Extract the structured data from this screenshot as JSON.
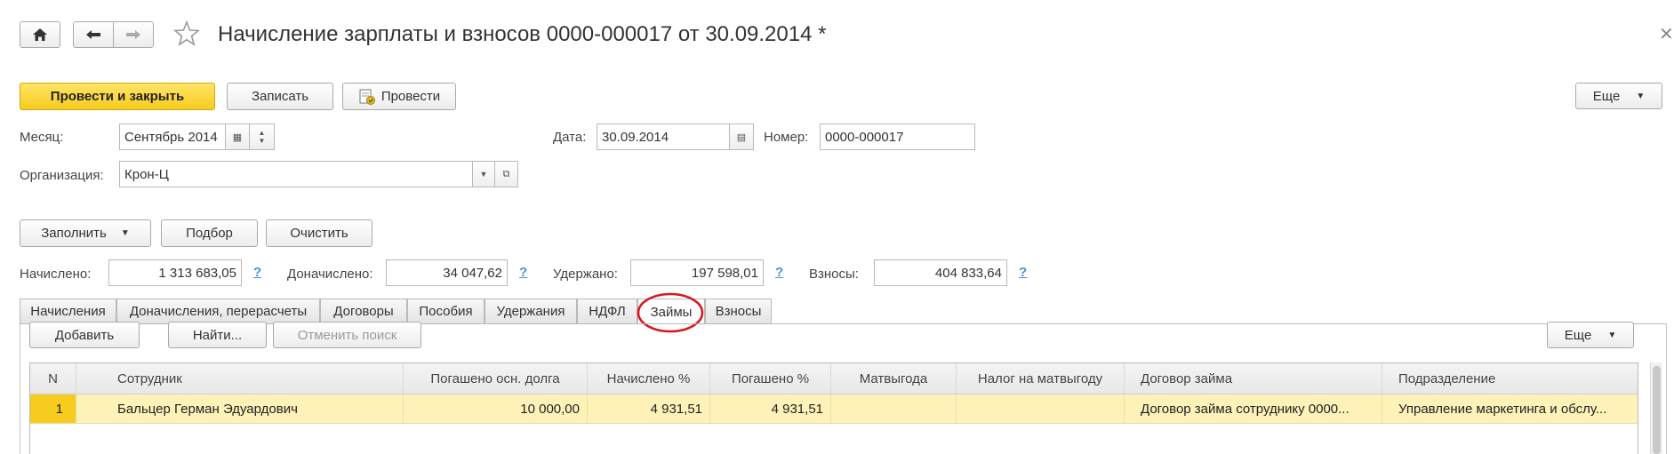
{
  "window": {
    "title": "Начисление зарплаты и взносов 0000-000017 от 30.09.2014 *"
  },
  "toolbar": {
    "post_close": "Провести и закрыть",
    "save": "Записать",
    "post": "Провести",
    "more": "Еще"
  },
  "header": {
    "month_label": "Месяц:",
    "month_value": "Сентябрь 2014",
    "date_label": "Дата:",
    "date_value": "30.09.2014",
    "number_label": "Номер:",
    "number_value": "0000-000017",
    "org_label": "Организация:",
    "org_value": "Крон-Ц"
  },
  "actions": {
    "fill": "Заполнить",
    "select": "Подбор",
    "clear": "Очистить"
  },
  "totals": {
    "accrued_label": "Начислено:",
    "accrued_value": "1 313 683,05",
    "additional_label": "Доначислено:",
    "additional_value": "34 047,62",
    "withheld_label": "Удержано:",
    "withheld_value": "197 598,01",
    "contrib_label": "Взносы:",
    "contrib_value": "404 833,64",
    "help": "?"
  },
  "tabs": [
    "Начисления",
    "Доначисления, перерасчеты",
    "Договоры",
    "Пособия",
    "Удержания",
    "НДФЛ",
    "Займы",
    "Взносы"
  ],
  "active_tab": "Займы",
  "tab_toolbar": {
    "add": "Добавить",
    "find": "Найти...",
    "cancel_search": "Отменить поиск",
    "more": "Еще"
  },
  "table": {
    "columns": [
      "N",
      "Сотрудник",
      "Погашено осн. долга",
      "Начислено %",
      "Погашено %",
      "Матвыгода",
      "Налог на матвыгоду",
      "Договор займа",
      "Подразделение"
    ],
    "rows": [
      {
        "n": "1",
        "employee": "Бальцер Герман Эдуардович",
        "principal_repaid": "10 000,00",
        "interest_accrued": "4 931,51",
        "interest_repaid": "4 931,51",
        "benefit": "",
        "benefit_tax": "",
        "loan_contract": "Договор займа сотруднику 0000...",
        "department": "Управление маркетинга и обслу..."
      }
    ]
  },
  "colors": {
    "accent_yellow": "#f7cc1f",
    "selected_row": "#fdf2b8",
    "highlight_circle": "#d7191f",
    "link_blue": "#4a90d9"
  }
}
